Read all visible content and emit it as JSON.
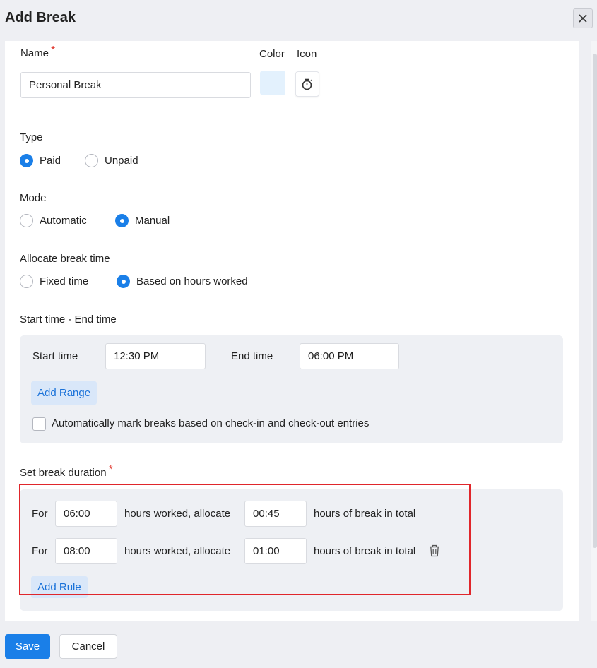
{
  "dialog": {
    "title": "Add Break"
  },
  "name_field": {
    "label": "Name",
    "required_mark": "*",
    "value": "Personal Break"
  },
  "color": {
    "label": "Color",
    "swatch": "#e3f1fd"
  },
  "icon": {
    "label": "Icon",
    "selected": "stopwatch-icon"
  },
  "type": {
    "label": "Type",
    "options": [
      "Paid",
      "Unpaid"
    ],
    "selected": "Paid"
  },
  "mode": {
    "label": "Mode",
    "options": [
      "Automatic",
      "Manual"
    ],
    "selected": "Manual"
  },
  "allocate": {
    "label": "Allocate break time",
    "options": [
      "Fixed time",
      "Based on hours worked"
    ],
    "selected": "Based on hours worked"
  },
  "time_range": {
    "label": "Start time - End time",
    "start_label": "Start time",
    "start_value": "12:30 PM",
    "end_label": "End time",
    "end_value": "06:00 PM",
    "add_range": "Add Range",
    "auto_mark_label": "Automatically mark breaks based on check-in and check-out entries",
    "auto_mark_checked": false
  },
  "duration": {
    "label": "Set break duration",
    "required_mark": "*",
    "rules": [
      {
        "for": "For",
        "hours": "06:00",
        "mid": "hours worked, allocate",
        "allocate": "00:45",
        "tail": "hours of break in total"
      },
      {
        "for": "For",
        "hours": "08:00",
        "mid": "hours worked, allocate",
        "allocate": "01:00",
        "tail": "hours of break in total"
      }
    ],
    "add_rule": "Add Rule"
  },
  "footer": {
    "save": "Save",
    "cancel": "Cancel"
  },
  "colors": {
    "accent": "#1a7fe8",
    "required": "#e0352b",
    "highlight": "#e0262b"
  }
}
